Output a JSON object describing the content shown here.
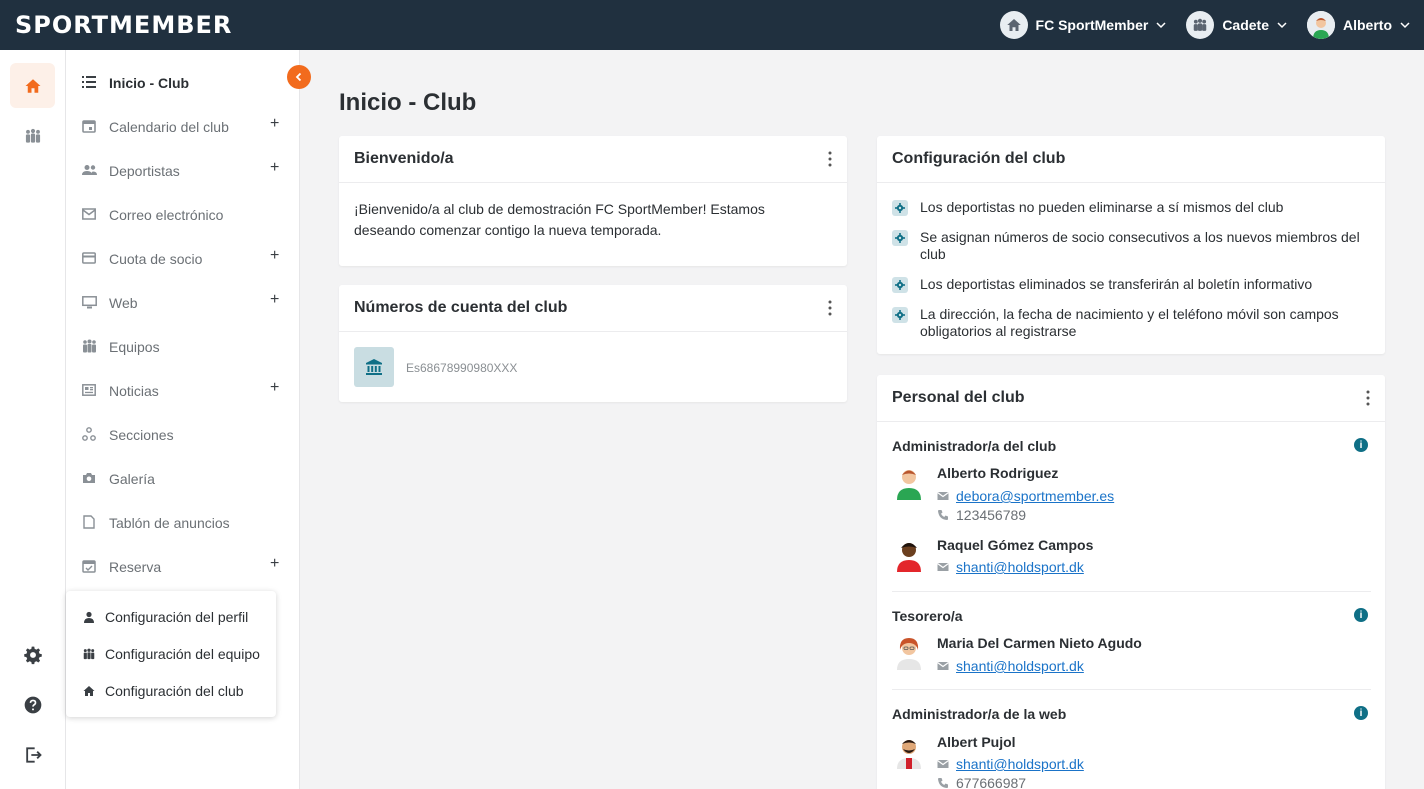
{
  "brand": {
    "logo_text": "SPORTMEMBER",
    "accent": "#f26b1d",
    "topbar_bg": "#20303f"
  },
  "topbar": {
    "club": "FC SportMember",
    "team": "Cadete",
    "user": "Alberto"
  },
  "sidebar": {
    "items": [
      {
        "label": "Inicio - Club",
        "icon": "list-icon",
        "active": true,
        "plus": false
      },
      {
        "label": "Calendario del club",
        "icon": "calendar-icon",
        "plus": true
      },
      {
        "label": "Deportistas",
        "icon": "people-icon",
        "plus": true
      },
      {
        "label": "Correo electrónico",
        "icon": "mail-icon",
        "plus": false
      },
      {
        "label": "Cuota de socio",
        "icon": "card-icon",
        "plus": true
      },
      {
        "label": "Web",
        "icon": "monitor-icon",
        "plus": true
      },
      {
        "label": "Equipos",
        "icon": "team-icon",
        "plus": false
      },
      {
        "label": "Noticias",
        "icon": "news-icon",
        "plus": true
      },
      {
        "label": "Secciones",
        "icon": "sections-icon",
        "plus": false
      },
      {
        "label": "Galería",
        "icon": "camera-icon",
        "plus": false
      },
      {
        "label": "Tablón de anuncios",
        "icon": "board-icon",
        "plus": false
      },
      {
        "label": "Reserva",
        "icon": "calendar-check-icon",
        "plus": true
      }
    ],
    "plus_symbol": "+"
  },
  "settings_menu": {
    "profile": "Configuración del perfil",
    "team": "Configuración del equipo",
    "club": "Configuración del club"
  },
  "main": {
    "page_title": "Inicio - Club",
    "welcome": {
      "title": "Bienvenido/a",
      "text": "¡Bienvenido/a al club de demostración FC SportMember! Estamos deseando comenzar contigo la nueva temporada."
    },
    "accounts": {
      "title": "Números de cuenta del club",
      "account": "Es68678990980XXX"
    },
    "config": {
      "title": "Configuración del club",
      "items": [
        "Los deportistas no pueden eliminarse a sí mismos del club",
        "Se asignan números de socio consecutivos a los nuevos miembros del club",
        "Los deportistas eliminados se transferirán al boletín informativo",
        "La dirección, la fecha de nacimiento y el teléfono móvil son campos obligatorios al registrarse"
      ]
    },
    "staff": {
      "title": "Personal del club",
      "roles": [
        {
          "title": "Administrador/a del club",
          "people": [
            {
              "name": "Alberto Rodriguez",
              "email": "debora@sportmember.es",
              "phone": "123456789"
            },
            {
              "name": "Raquel Gómez Campos",
              "email": "shanti@holdsport.dk"
            }
          ]
        },
        {
          "title": "Tesorero/a",
          "people": [
            {
              "name": "Maria Del Carmen Nieto Agudo",
              "email": "shanti@holdsport.dk"
            }
          ]
        },
        {
          "title": "Administrador/a de la web",
          "people": [
            {
              "name": "Albert Pujol",
              "email": "shanti@holdsport.dk",
              "phone": "677666987"
            }
          ]
        }
      ]
    }
  }
}
